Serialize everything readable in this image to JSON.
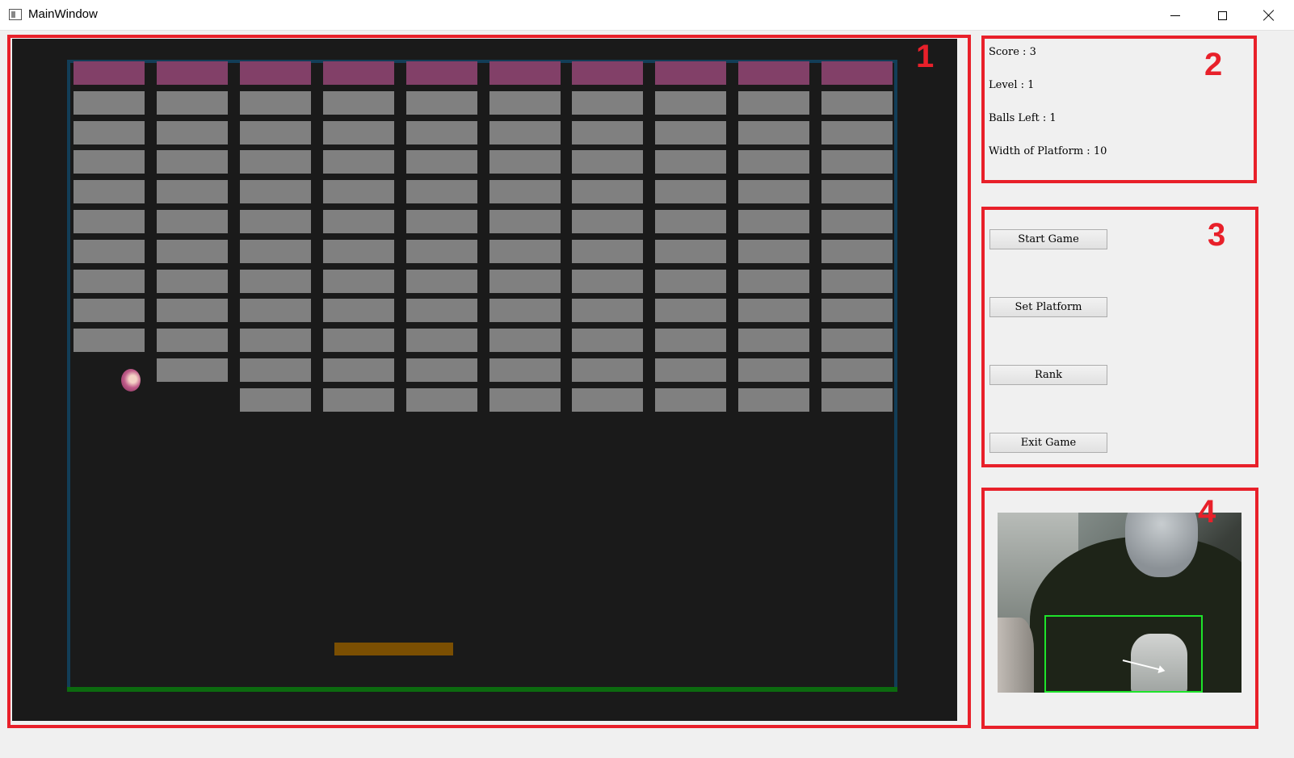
{
  "window": {
    "title": "MainWindow"
  },
  "annotations": [
    "1",
    "2",
    "3",
    "4"
  ],
  "stats": {
    "score": "Score : 3",
    "level": "Level : 1",
    "balls_left": "Balls Left : 1",
    "platform_width": "Width of Platform : 10"
  },
  "buttons": {
    "start": "Start Game",
    "set_platform": "Set Platform",
    "rank": "Rank",
    "exit": "Exit Game"
  },
  "game": {
    "columns": 10,
    "remaining_rows_per_column": [
      10,
      11,
      12,
      12,
      12,
      12,
      12,
      12,
      12,
      12
    ],
    "colors": {
      "background": "#1a1a1a",
      "wall": "#123e58",
      "floor": "#0c6a0f",
      "brick": "#808080",
      "top_brick": "#824068",
      "paddle": "#7b4f02",
      "annotation": "#e8202a",
      "tracking_box": "#1ee32a"
    }
  },
  "icons": [
    "app-window-icon",
    "minimize-icon",
    "maximize-icon",
    "close-icon",
    "ball",
    "paddle",
    "motion-arrow"
  ]
}
